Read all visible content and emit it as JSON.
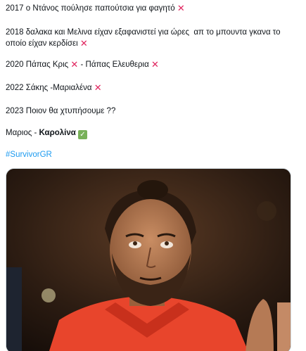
{
  "tweet": {
    "lines": [
      {
        "text": "2017 ο Ντάνος πούλησε παπούτσια για φαγητό "
      },
      {
        "text": "2018 δαλακα και Μελινα είχαν εξαφανιστεί για ώρες  απ το μπουντα γκανα το οποίο είχαν κερδίσει "
      },
      {
        "text_a": "2020 Πάπας Κρις ",
        "text_b": " - Πάπας Ελευθερια "
      },
      {
        "text": "2022 Σάκης -Μαριαλένα "
      },
      {
        "text": "2023 Ποιον θα χτυπήσουμε ??"
      },
      {
        "text_a": "Μαριος - ",
        "text_bold": "Καρολίνα",
        "text_b": " "
      }
    ],
    "hashtag": "#SurvivorGR",
    "icons": {
      "cross": "cross-mark-icon",
      "check": "check-mark-icon"
    },
    "glyphs": {
      "cross": "✕",
      "check": "✓"
    },
    "colors": {
      "text": "#0f1419",
      "hashtag": "#1d9bf0",
      "cross": "#e0245e",
      "check": "#78b159"
    }
  },
  "media": {
    "type": "photo",
    "description_icon": "tweet-photo"
  }
}
